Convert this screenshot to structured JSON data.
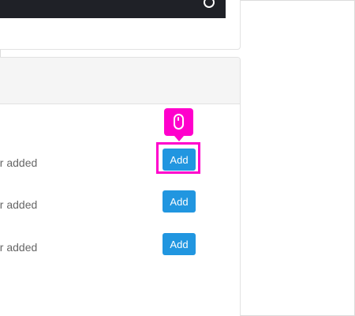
{
  "list": {
    "rows": [
      {
        "text": "or added",
        "button_label": "Add"
      },
      {
        "text": "or added",
        "button_label": "Add"
      },
      {
        "text": "or added",
        "button_label": "Add"
      }
    ]
  },
  "annotation": {
    "click_marker_icon": "mouse-icon",
    "highlight_color": "#ff00cc"
  },
  "colors": {
    "button": "#2196e0",
    "top_bar": "#1f2127",
    "panel_header": "#f5f5f5"
  }
}
